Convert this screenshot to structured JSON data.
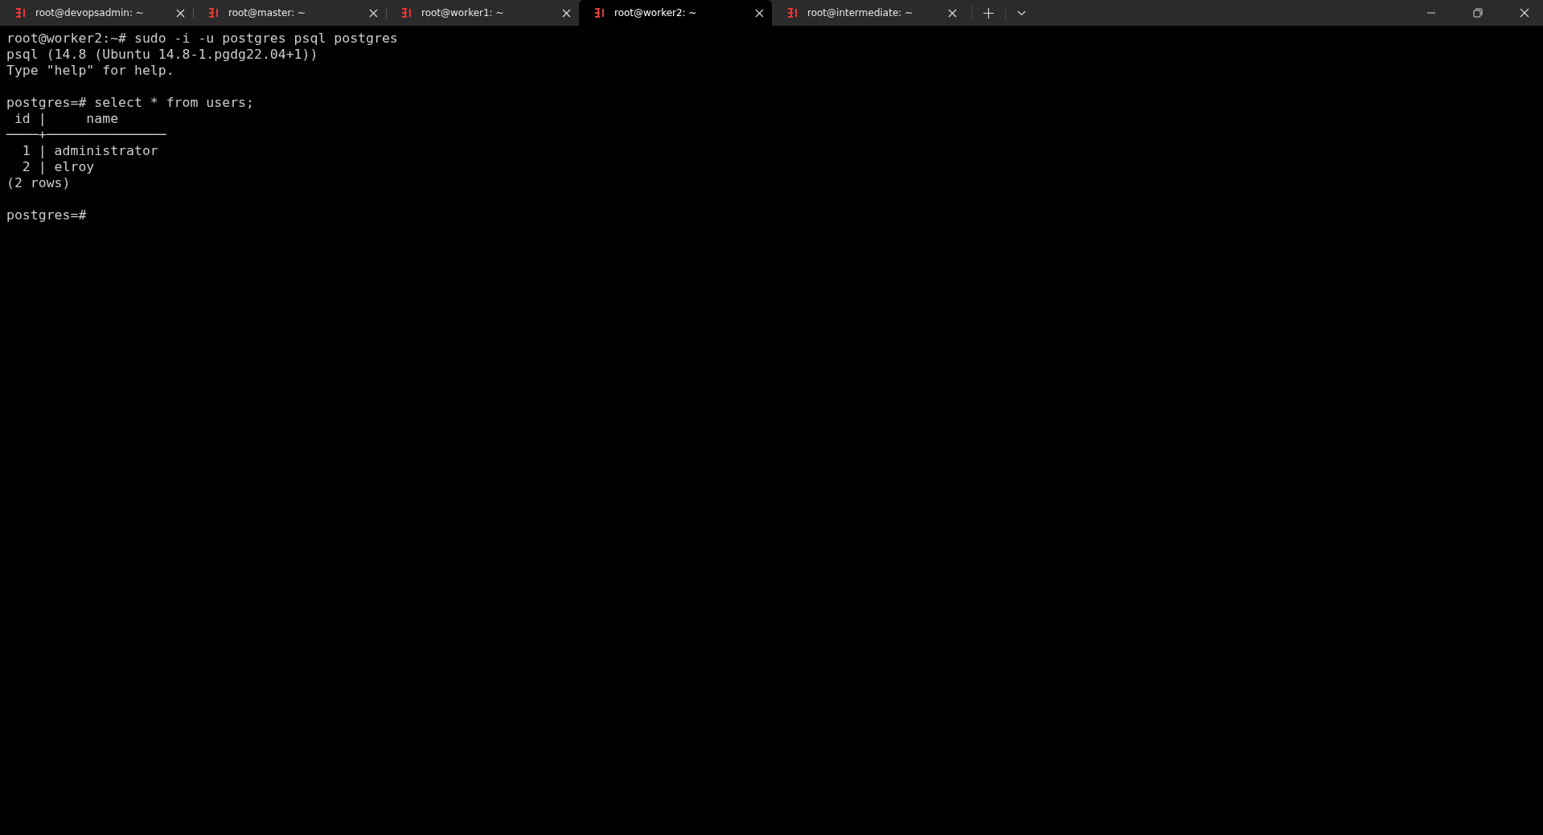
{
  "tabs": [
    {
      "title": "root@devopsadmin: ~",
      "selected": false
    },
    {
      "title": "root@master: ~",
      "selected": false
    },
    {
      "title": "root@worker1: ~",
      "selected": false
    },
    {
      "title": "root@worker2: ~",
      "selected": true
    },
    {
      "title": "root@intermediate: ~",
      "selected": false
    }
  ],
  "terminal": {
    "blocks": [
      [
        "root@worker2:~# sudo -i -u postgres psql postgres",
        "psql (14.8 (Ubuntu 14.8-1.pgdg22.04+1))",
        "Type \"help\" for help."
      ],
      [
        "postgres=# select * from users;",
        " id |     name",
        "────+───────────────",
        "  1 | administrator",
        "  2 | elroy",
        "(2 rows)"
      ],
      [
        "postgres=#"
      ]
    ]
  }
}
